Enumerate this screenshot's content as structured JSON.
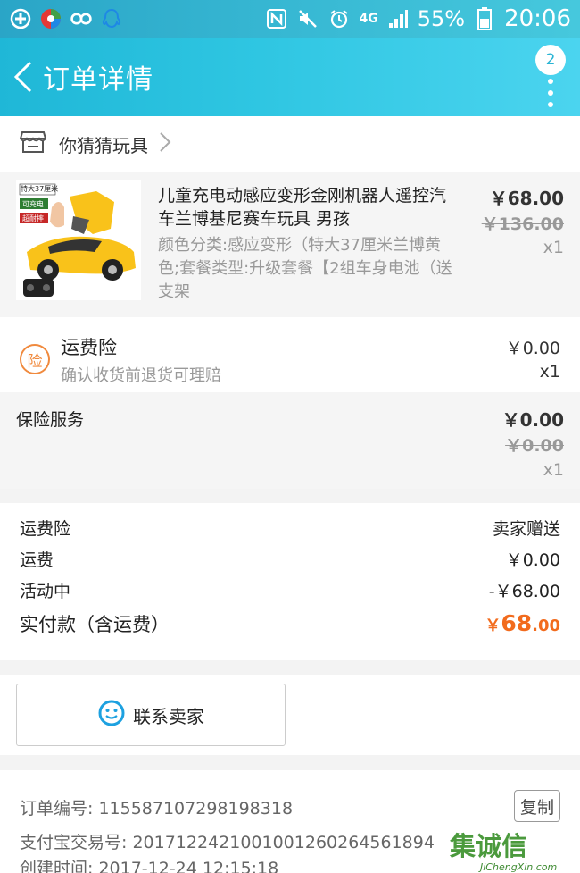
{
  "status_bar": {
    "battery": "55%",
    "time": "20:06",
    "network": "4G",
    "colors": {
      "bg": "#34b3d0"
    }
  },
  "header": {
    "title": "订单详情",
    "badge_count": "2"
  },
  "shop": {
    "name": "你猜猜玩具"
  },
  "product": {
    "title": "儿童充电动感应变形金刚机器人遥控汽车兰博基尼赛车玩具 男孩",
    "spec": "颜色分类:感应变形（特大37厘米兰博黄色;套餐类型:升级套餐【2组车身电池（送支架",
    "price": "￥68.00",
    "original_price": "￥136.00",
    "quantity": "x1",
    "image_labels": [
      "特大37厘米",
      "可充电",
      "超耐摔"
    ]
  },
  "shipping_insurance": {
    "icon_char": "险",
    "name": "运费险",
    "desc": "确认收货前退货可理赔",
    "amount": "￥0.00",
    "quantity": "x1"
  },
  "insurance_service": {
    "name": "保险服务",
    "amount": "￥0.00",
    "original_amount": "￥0.00",
    "quantity": "x1"
  },
  "summary": {
    "rows": [
      {
        "label": "运费险",
        "value": "卖家赠送"
      },
      {
        "label": "运费",
        "value": "￥0.00"
      },
      {
        "label": "活动中",
        "value": "-￥68.00"
      }
    ],
    "total_label": "实付款（含运费）",
    "total_symbol": "￥",
    "total_int": "68",
    "total_dec": ".00",
    "accent": "#f26b1d"
  },
  "contact": {
    "label": "联系卖家"
  },
  "order_info": {
    "order_no": "订单编号: 115587107298198318",
    "alipay_no": "支付宝交易号: 2017122421001001260264561894",
    "created": "创建时间: 2017-12-24 12:15:18",
    "copy_label": "复制"
  },
  "watermark": {
    "cn": "集诚信",
    "en": "JiChengXin.com"
  }
}
